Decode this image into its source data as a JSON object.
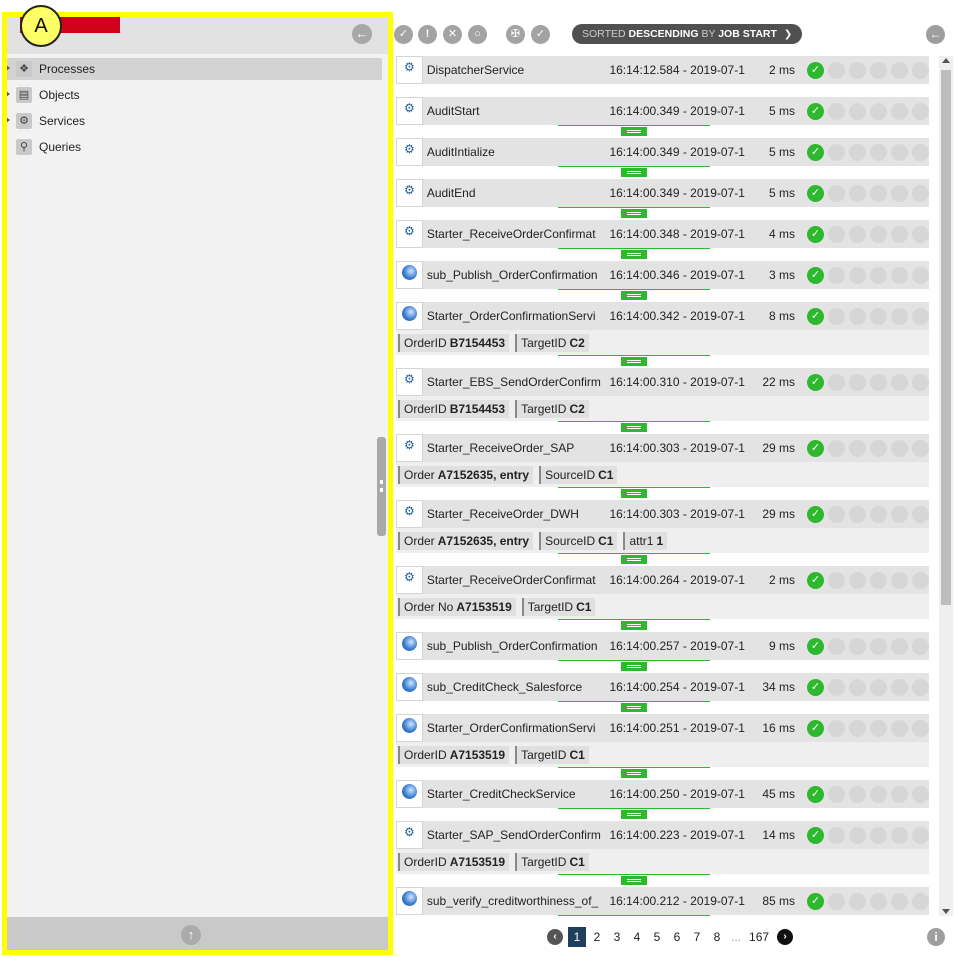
{
  "annotation": {
    "label": "A"
  },
  "sidebar": {
    "items": [
      {
        "label": "Processes",
        "icon": "processes-icon",
        "selected": true
      },
      {
        "label": "Objects",
        "icon": "objects-icon",
        "selected": false
      },
      {
        "label": "Services",
        "icon": "services-icon",
        "selected": false
      },
      {
        "label": "Queries",
        "icon": "search-icon",
        "selected": false
      }
    ]
  },
  "toolbar": {
    "sort_prefix": "SORTED",
    "sort_order": "DESCENDING",
    "sort_by_word": "BY",
    "sort_field": "JOB START"
  },
  "jobs": [
    {
      "name": "DispatcherService",
      "time": "16:14:12.584 - 2019-07-15",
      "duration": "2 ms",
      "type": "gear",
      "props": []
    },
    {
      "name": "AuditStart",
      "time": "16:14:00.349 - 2019-07-15",
      "duration": "5 ms",
      "type": "gear",
      "props": []
    },
    {
      "name": "AuditIntialize",
      "time": "16:14:00.349 - 2019-07-15",
      "duration": "5 ms",
      "type": "gear",
      "props": []
    },
    {
      "name": "AuditEnd",
      "time": "16:14:00.349 - 2019-07-15",
      "duration": "5 ms",
      "type": "gear",
      "props": []
    },
    {
      "name": "Starter_ReceiveOrderConfirmat",
      "time": "16:14:00.348 - 2019-07-15",
      "duration": "4 ms",
      "type": "gear",
      "props": []
    },
    {
      "name": "sub_Publish_OrderConfirmation",
      "time": "16:14:00.346 - 2019-07-15",
      "duration": "3 ms",
      "type": "bpel",
      "props": []
    },
    {
      "name": "Starter_OrderConfirmationServi",
      "time": "16:14:00.342 - 2019-07-15",
      "duration": "8 ms",
      "type": "bpel",
      "props": [
        {
          "key": "OrderID",
          "value": "B7154453"
        },
        {
          "key": "TargetID",
          "value": "C2"
        }
      ]
    },
    {
      "name": "Starter_EBS_SendOrderConfirm",
      "time": "16:14:00.310 - 2019-07-15",
      "duration": "22 ms",
      "type": "gear",
      "props": [
        {
          "key": "OrderID",
          "value": "B7154453"
        },
        {
          "key": "TargetID",
          "value": "C2"
        }
      ]
    },
    {
      "name": "Starter_ReceiveOrder_SAP",
      "time": "16:14:00.303 - 2019-07-15",
      "duration": "29 ms",
      "type": "gear",
      "props": [
        {
          "key": "Order",
          "value": "A7152635, entry"
        },
        {
          "key": "SourceID",
          "value": "C1"
        }
      ]
    },
    {
      "name": "Starter_ReceiveOrder_DWH",
      "time": "16:14:00.303 - 2019-07-15",
      "duration": "29 ms",
      "type": "gear",
      "props": [
        {
          "key": "Order",
          "value": "A7152635, entry"
        },
        {
          "key": "SourceID",
          "value": "C1"
        },
        {
          "key": "attr1",
          "value": "1"
        }
      ]
    },
    {
      "name": "Starter_ReceiveOrderConfirmat",
      "time": "16:14:00.264 - 2019-07-15",
      "duration": "2 ms",
      "type": "gear",
      "props": [
        {
          "key": "Order No",
          "value": "A7153519"
        },
        {
          "key": "TargetID",
          "value": "C1"
        }
      ]
    },
    {
      "name": "sub_Publish_OrderConfirmation",
      "time": "16:14:00.257 - 2019-07-15",
      "duration": "9 ms",
      "type": "bpel",
      "props": []
    },
    {
      "name": "sub_CreditCheck_Salesforce",
      "time": "16:14:00.254 - 2019-07-15",
      "duration": "34 ms",
      "type": "bpel",
      "props": []
    },
    {
      "name": "Starter_OrderConfirmationServi",
      "time": "16:14:00.251 - 2019-07-15",
      "duration": "16 ms",
      "type": "bpel",
      "props": [
        {
          "key": "OrderID",
          "value": "A7153519"
        },
        {
          "key": "TargetID",
          "value": "C1"
        }
      ]
    },
    {
      "name": "Starter_CreditCheckService",
      "time": "16:14:00.250 - 2019-07-15",
      "duration": "45 ms",
      "type": "bpel",
      "props": []
    },
    {
      "name": "Starter_SAP_SendOrderConfirm",
      "time": "16:14:00.223 - 2019-07-15",
      "duration": "14 ms",
      "type": "gear",
      "props": [
        {
          "key": "OrderID",
          "value": "A7153519"
        },
        {
          "key": "TargetID",
          "value": "C1"
        }
      ]
    },
    {
      "name": "sub_verify_creditworthiness_of_",
      "time": "16:14:00.212 - 2019-07-15",
      "duration": "85 ms",
      "type": "bpel",
      "props": []
    }
  ],
  "pagination": {
    "pages": [
      "1",
      "2",
      "3",
      "4",
      "5",
      "6",
      "7",
      "8"
    ],
    "current": "1",
    "ellipsis": "...",
    "last": "167"
  },
  "colors": {
    "ok": "#2eb82e",
    "accent_red": "#d0021b",
    "annotation": "#ffff00"
  }
}
